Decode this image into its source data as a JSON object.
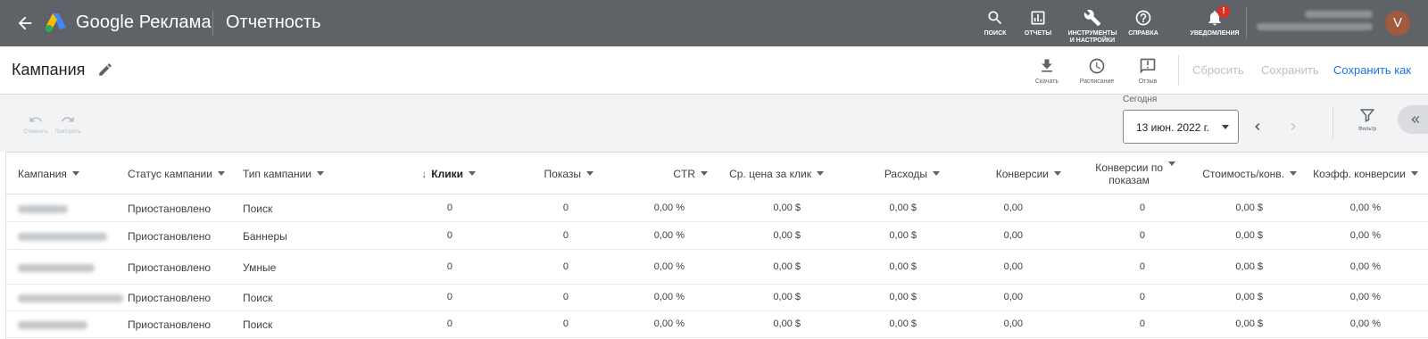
{
  "app": {
    "brand": "Google Реклама",
    "section": "Отчетность"
  },
  "topbar": {
    "tools": [
      {
        "label": "ПОИСК",
        "icon": "search-icon"
      },
      {
        "label": "ОТЧЕТЫ",
        "icon": "reports-icon"
      },
      {
        "label_line1": "ИНСТРУМЕНТЫ",
        "label_line2": "И НАСТРОЙКИ",
        "icon": "wrench-icon"
      },
      {
        "label": "СПРАВКА",
        "icon": "help-icon"
      },
      {
        "label": "УВЕДОМЛЕНИЯ",
        "icon": "bell-icon",
        "badge": "!"
      }
    ],
    "avatar_letter": "V"
  },
  "titlebar": {
    "title": "Кампания",
    "actions": [
      {
        "label": "Скачать",
        "icon": "download-icon"
      },
      {
        "label": "Расписание",
        "icon": "schedule-icon"
      },
      {
        "label": "Отзыв",
        "icon": "feedback-icon"
      }
    ],
    "reset": "Сбросить",
    "save": "Сохранить",
    "save_as": "Сохранить как"
  },
  "toolbar": {
    "undo": "Отменить",
    "redo": "Повторить",
    "date_caption": "Сегодня",
    "date_value": "13 июн. 2022 г.",
    "filter": "Фильтр"
  },
  "table": {
    "headers": {
      "campaign": "Кампания",
      "status": "Статус кампании",
      "type": "Тип кампании",
      "clicks": "Клики",
      "impressions": "Показы",
      "ctr": "CTR",
      "avg_cpc": "Ср. цена за клик",
      "cost": "Расходы",
      "conversions": "Конверсии",
      "viewthrough_line1": "Конверсии по",
      "viewthrough_line2": "показам",
      "cost_per_conv": "Стоимость/конв.",
      "conv_rate": "Коэфф. конверсии"
    },
    "rows": [
      {
        "status": "Приостановлено",
        "type": "Поиск",
        "clicks": "0",
        "impressions": "0",
        "ctr": "0,00 %",
        "avg_cpc": "0,00 $",
        "cost": "0,00 $",
        "conversions": "0,00",
        "viewthrough": "0",
        "cost_per_conv": "0,00 $",
        "conv_rate": "0,00 %"
      },
      {
        "status": "Приостановлено",
        "type": "Баннеры",
        "clicks": "0",
        "impressions": "0",
        "ctr": "0,00 %",
        "avg_cpc": "0,00 $",
        "cost": "0,00 $",
        "conversions": "0,00",
        "viewthrough": "0",
        "cost_per_conv": "0,00 $",
        "conv_rate": "0,00 %"
      },
      {
        "status": "Приостановлено",
        "type": "Умные",
        "clicks": "0",
        "impressions": "0",
        "ctr": "0,00 %",
        "avg_cpc": "0,00 $",
        "cost": "0,00 $",
        "conversions": "0,00",
        "viewthrough": "0",
        "cost_per_conv": "0,00 $",
        "conv_rate": "0,00 %"
      },
      {
        "status": "Приостановлено",
        "type": "Поиск",
        "clicks": "0",
        "impressions": "0",
        "ctr": "0,00 %",
        "avg_cpc": "0,00 $",
        "cost": "0,00 $",
        "conversions": "0,00",
        "viewthrough": "0",
        "cost_per_conv": "0,00 $",
        "conv_rate": "0,00 %"
      },
      {
        "status": "Приостановлено",
        "type": "Поиск",
        "clicks": "0",
        "impressions": "0",
        "ctr": "0,00 %",
        "avg_cpc": "0,00 $",
        "cost": "0,00 $",
        "conversions": "0,00",
        "viewthrough": "0",
        "cost_per_conv": "0,00 $",
        "conv_rate": "0,00 %"
      }
    ]
  }
}
